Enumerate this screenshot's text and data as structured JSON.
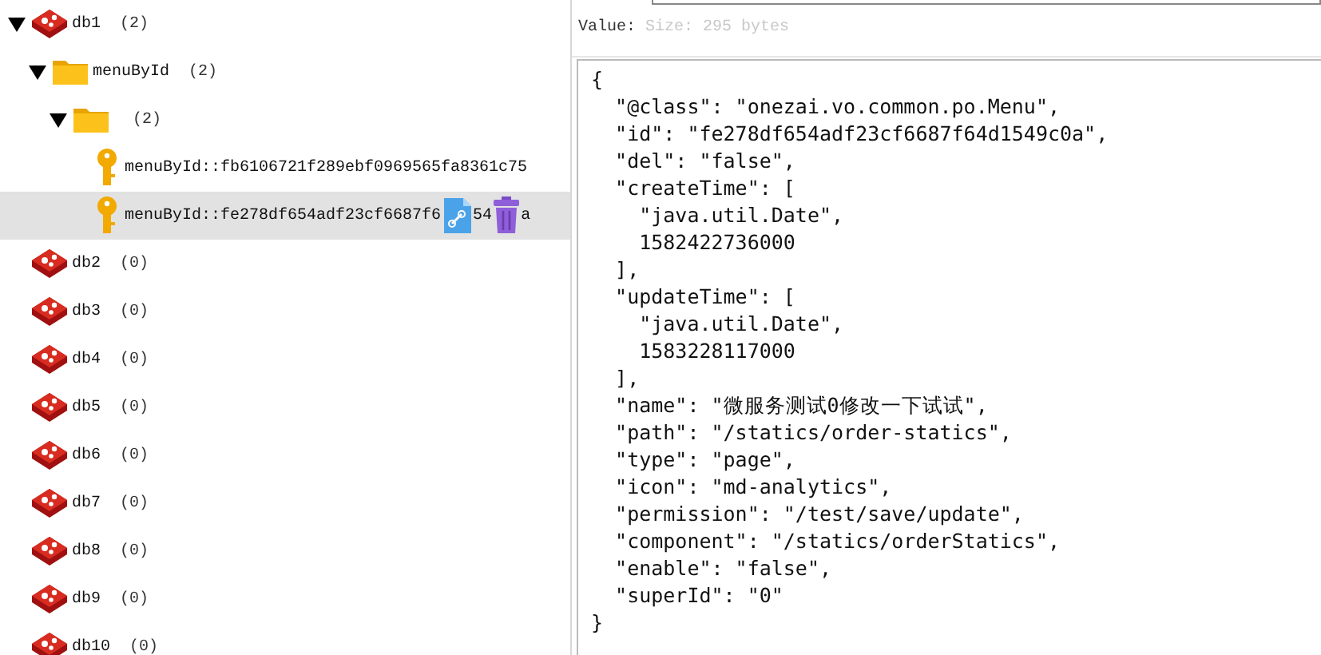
{
  "tree": [
    {
      "kind": "db",
      "label": "db1",
      "count": "(2)",
      "expanded": true,
      "selected": false,
      "children": [
        {
          "kind": "folder",
          "label": "menuById",
          "count": "(2)",
          "expanded": true,
          "selected": false,
          "children": [
            {
              "kind": "folder",
              "count": "(2)",
              "expanded": true,
              "selected": false,
              "children": [
                {
                  "kind": "key",
                  "label": "menuById::fb6106721f289ebf0969565fa8361c75",
                  "selected": false
                },
                {
                  "kind": "key",
                  "segments": [
                    {
                      "kind": "text",
                      "text": "menuById::fe278df654adf23cf6687f6"
                    },
                    {
                      "kind": "copy"
                    },
                    {
                      "kind": "text",
                      "text": "54"
                    },
                    {
                      "kind": "delete"
                    },
                    {
                      "kind": "text",
                      "text": "a"
                    }
                  ],
                  "selected": true
                }
              ]
            }
          ]
        }
      ]
    },
    {
      "kind": "db",
      "label": "db2",
      "count": "(0)",
      "selected": false
    },
    {
      "kind": "db",
      "label": "db3",
      "count": "(0)",
      "selected": false
    },
    {
      "kind": "db",
      "label": "db4",
      "count": "(0)",
      "selected": false
    },
    {
      "kind": "db",
      "label": "db5",
      "count": "(0)",
      "selected": false
    },
    {
      "kind": "db",
      "label": "db6",
      "count": "(0)",
      "selected": false
    },
    {
      "kind": "db",
      "label": "db7",
      "count": "(0)",
      "selected": false
    },
    {
      "kind": "db",
      "label": "db8",
      "count": "(0)",
      "selected": false
    },
    {
      "kind": "db",
      "label": "db9",
      "count": "(0)",
      "selected": false
    },
    {
      "kind": "db",
      "label": "db10",
      "count": "(0)",
      "selected": false
    }
  ],
  "value_panel": {
    "label": "Value:",
    "size": "Size: 295 bytes",
    "lines": [
      "{",
      "  \"@class\": \"onezai.vo.common.po.Menu\",",
      "  \"id\": \"fe278df654adf23cf6687f64d1549c0a\",",
      "  \"del\": \"false\",",
      "  \"createTime\": [",
      "    \"java.util.Date\",",
      "    1582422736000",
      "  ],",
      "  \"updateTime\": [",
      "    \"java.util.Date\",",
      "    1583228117000",
      "  ],",
      "  \"name\": \"微服务测试0修改一下试试\",",
      "  \"path\": \"/statics/order-statics\",",
      "  \"type\": \"page\",",
      "  \"icon\": \"md-analytics\",",
      "  \"permission\": \"/test/save/update\",",
      "  \"component\": \"/statics/orderStatics\",",
      "  \"enable\": \"false\",",
      "  \"superId\": \"0\"",
      "}"
    ]
  }
}
